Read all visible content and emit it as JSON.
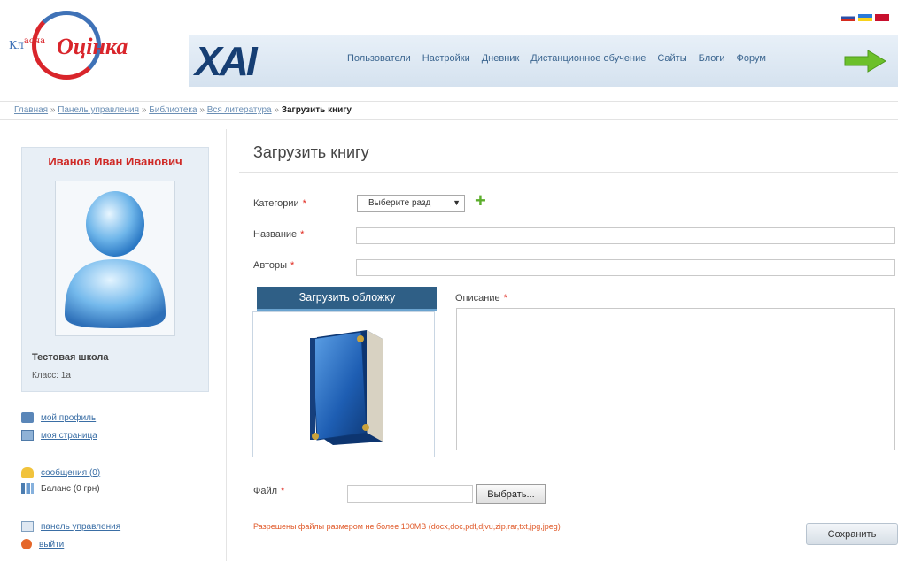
{
  "logo": {
    "part1": "Кл",
    "part2": "асна",
    "part3": "Оцінка"
  },
  "brand": "XAI",
  "top_nav": [
    "Пользователи",
    "Настройки",
    "Дневник",
    "Дистанционное обучение",
    "Сайты",
    "Блоги",
    "Форум"
  ],
  "languages": [
    "ru",
    "ua",
    "en"
  ],
  "breadcrumb": {
    "links": [
      "Главная",
      "Панель управления",
      "Библиотека",
      "Вся литература"
    ],
    "separator": "»",
    "current": "Загрузить книгу"
  },
  "profile": {
    "name": "Иванов Иван Иванович",
    "school": "Тестовая школа",
    "class": "Класс: 1а"
  },
  "side_menu": {
    "my_profile": "мой профиль",
    "my_page": "моя страница",
    "messages": "сообщения (0)",
    "balance": "Баланс (0 грн)",
    "control_panel": "панель управления",
    "logout": "выйти"
  },
  "form": {
    "title": "Загрузить книгу",
    "category_label": "Категории",
    "category_select": "Выберите разд",
    "name_label": "Название",
    "authors_label": "Авторы",
    "upload_cover": "Загрузить обложку",
    "description_label": "Описание",
    "file_label": "Файл",
    "choose_button": "Выбрать...",
    "allowed_files": "Разрешены файлы размером не более 100MB (docx,doc,pdf,djvu,zip,rar,txt,jpg,jpeg)",
    "save_button": "Сохранить",
    "required_mark": "*"
  },
  "colors": {
    "accent_red": "#d9252b",
    "accent_blue": "#2f5f86",
    "link": "#3a6ea5",
    "plus_green": "#5cae2c"
  }
}
